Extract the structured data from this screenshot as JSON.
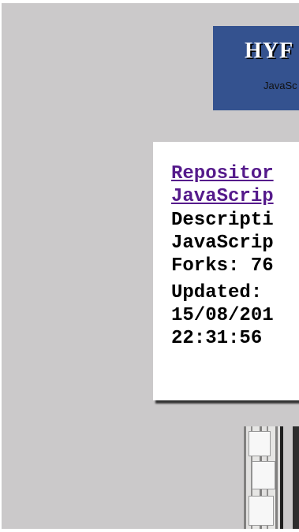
{
  "header": {
    "title": "HYF",
    "subtitle": "JavaSc"
  },
  "repo_card": {
    "repository_label_line1": "Repositor",
    "repository_label_line2": "JavaScrip",
    "description_line1": "Descripti",
    "description_line2": "JavaScrip",
    "forks": "Forks: 76",
    "updated_label": "Updated:",
    "updated_date": "15/08/201",
    "updated_time": "22:31:56"
  },
  "colors": {
    "background": "#cbc9ca",
    "header": "#34528f",
    "link": "#551a8b"
  },
  "contributors": {
    "icon": "contributor-photo"
  }
}
